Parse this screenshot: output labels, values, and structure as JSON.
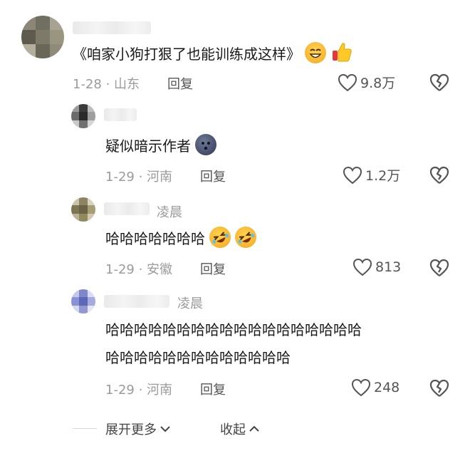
{
  "comments": [
    {
      "reply_to": "",
      "text": "《咱家小狗打狠了也能训练成这样》",
      "emojis": [
        "grin-emoji",
        "thumbs-up-emoji"
      ],
      "date_location": "1-28 · 山东",
      "reply_label": "回复",
      "likes": "9.8万"
    },
    {
      "reply_to": "",
      "text": "疑似暗示作者",
      "emojis": [
        "dark-moon-face-emoji"
      ],
      "date_location": "1-29 · 河南",
      "reply_label": "回复",
      "likes": "1.2万"
    },
    {
      "reply_to": "凌晨",
      "text": "哈哈哈哈哈哈哈",
      "emojis": [
        "rofl-emoji",
        "rofl-emoji"
      ],
      "date_location": "1-29 · 安徽",
      "reply_label": "回复",
      "likes": "813"
    },
    {
      "reply_to": "凌晨",
      "text_line1": "哈哈哈哈哈哈哈哈哈哈哈哈哈哈哈哈哈哈",
      "text_line2": "哈哈哈哈哈哈哈哈哈哈哈哈哈",
      "date_location": "1-29 · 河南",
      "reply_label": "回复",
      "likes": "248"
    }
  ],
  "footer": {
    "expand_label": "展开更多",
    "collapse_label": "收起"
  },
  "colors": {
    "meta": "#9b9b9b",
    "text": "#1a1a1a",
    "icon": "#555555"
  }
}
